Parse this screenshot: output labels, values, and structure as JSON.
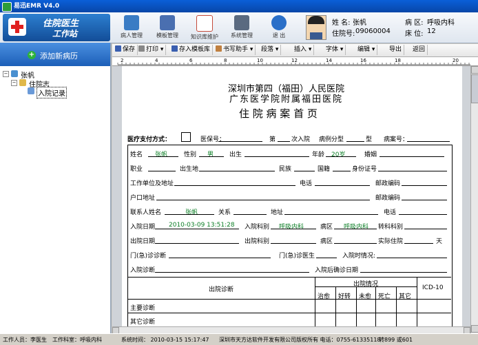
{
  "window": {
    "title": "易迅EMR V4.0"
  },
  "logo": {
    "line1": "住院医生",
    "line2": "工作站"
  },
  "toolbar": {
    "items": [
      {
        "label": "病人管理",
        "icon": "patient-icon",
        "color": "#3a7cc4"
      },
      {
        "label": "模板管理",
        "icon": "template-icon",
        "color": "#4a6fb0"
      },
      {
        "label": "知识库维护",
        "icon": "knowledge-icon",
        "color": "#c44a3a"
      },
      {
        "label": "系统管理",
        "icon": "monitor-icon",
        "color": "#5a6a80"
      },
      {
        "label": "退 出",
        "icon": "exit-icon",
        "color": "#2a6fc8"
      }
    ]
  },
  "patient": {
    "name_label": "姓 名:",
    "name": "张帆",
    "hosp_label": "住院号:",
    "hosp_no": "09060004",
    "ward_label": "病 区:",
    "ward": "呼吸内科",
    "bed_label": "床 位:",
    "bed": "12"
  },
  "sidebar": {
    "add_label": "添加新病历",
    "tree": [
      {
        "label": "张帆",
        "level": 0
      },
      {
        "label": "住院志",
        "level": 1
      },
      {
        "label": "入院记录",
        "level": 2
      }
    ]
  },
  "editor_toolbar": {
    "buttons": [
      "保存",
      "打印",
      "存入模板库",
      "书写助手",
      "段落",
      "插入",
      "字体",
      "编辑",
      "导出",
      "返回"
    ]
  },
  "ruler": {
    "marks": [
      "2",
      "4",
      "6",
      "8",
      "10",
      "12",
      "14",
      "16",
      "18",
      "20"
    ]
  },
  "document": {
    "hospital1": "深圳市第四（福田）人民医院",
    "hospital2": "广东医学院附属福田医院",
    "title": "住 院 病 案 首 页",
    "pay_label": "医疗支付方式：",
    "ins_label": "医保号：",
    "times_label": "第",
    "times_suffix": "次入院",
    "type_label": "病例分型",
    "type_suffix": "型",
    "case_label": "病案号：",
    "f_name": "姓名",
    "v_name": "张帆",
    "f_sex": "性别",
    "v_sex": "男",
    "f_birth": "出生",
    "f_age": "年龄",
    "v_age": "20岁",
    "f_marry": "婚姻",
    "f_job": "职业",
    "f_birthplace": "出生地",
    "f_nation": "民族",
    "f_country": "国籍",
    "f_id": "身份证号",
    "f_work": "工作单位及地址",
    "f_phone": "电话",
    "f_zip": "邮政编码",
    "f_hukou": "户口地址",
    "f_zip2": "邮政编码",
    "f_contact": "联系人姓名",
    "v_contact": "张帆",
    "f_rel": "关系",
    "f_addr": "地址",
    "f_phone2": "电话",
    "f_indate": "入院日期",
    "v_indate": "2010-03-09 13:51:28",
    "f_indept": "入院科别",
    "v_indept": "呼吸内科",
    "f_inward": "病区",
    "v_inward": "呼吸内科",
    "f_transfer": "转科科别",
    "f_outdate": "出院日期",
    "f_outdept": "出院科别",
    "f_outward": "病区",
    "f_actual": "实际住院",
    "f_day": "天",
    "f_emdx": "门(急)诊诊断",
    "f_emdoc": "门(急)诊医生",
    "f_incond": "入院时情况:",
    "f_indx": "入院诊断",
    "f_confirm": "入院后确诊日期",
    "tbl_dx": "出院诊断",
    "tbl_status": "出院情况",
    "tbl_cols": [
      "治愈",
      "好转",
      "未愈",
      "死亡",
      "其它"
    ],
    "tbl_icd": "ICD-10",
    "tbl_main": "主要诊断",
    "tbl_other": "其它诊断"
  },
  "statusbar": {
    "operator": "工作人员：李医生",
    "dept": "工作科室：呼吸内科",
    "time": "系统时间： 2010-03-15 15:17:47",
    "company": "深圳市天方达软件开发有限公司版权所有  电话：0755-61335118",
    "ext": "转899 或601"
  }
}
